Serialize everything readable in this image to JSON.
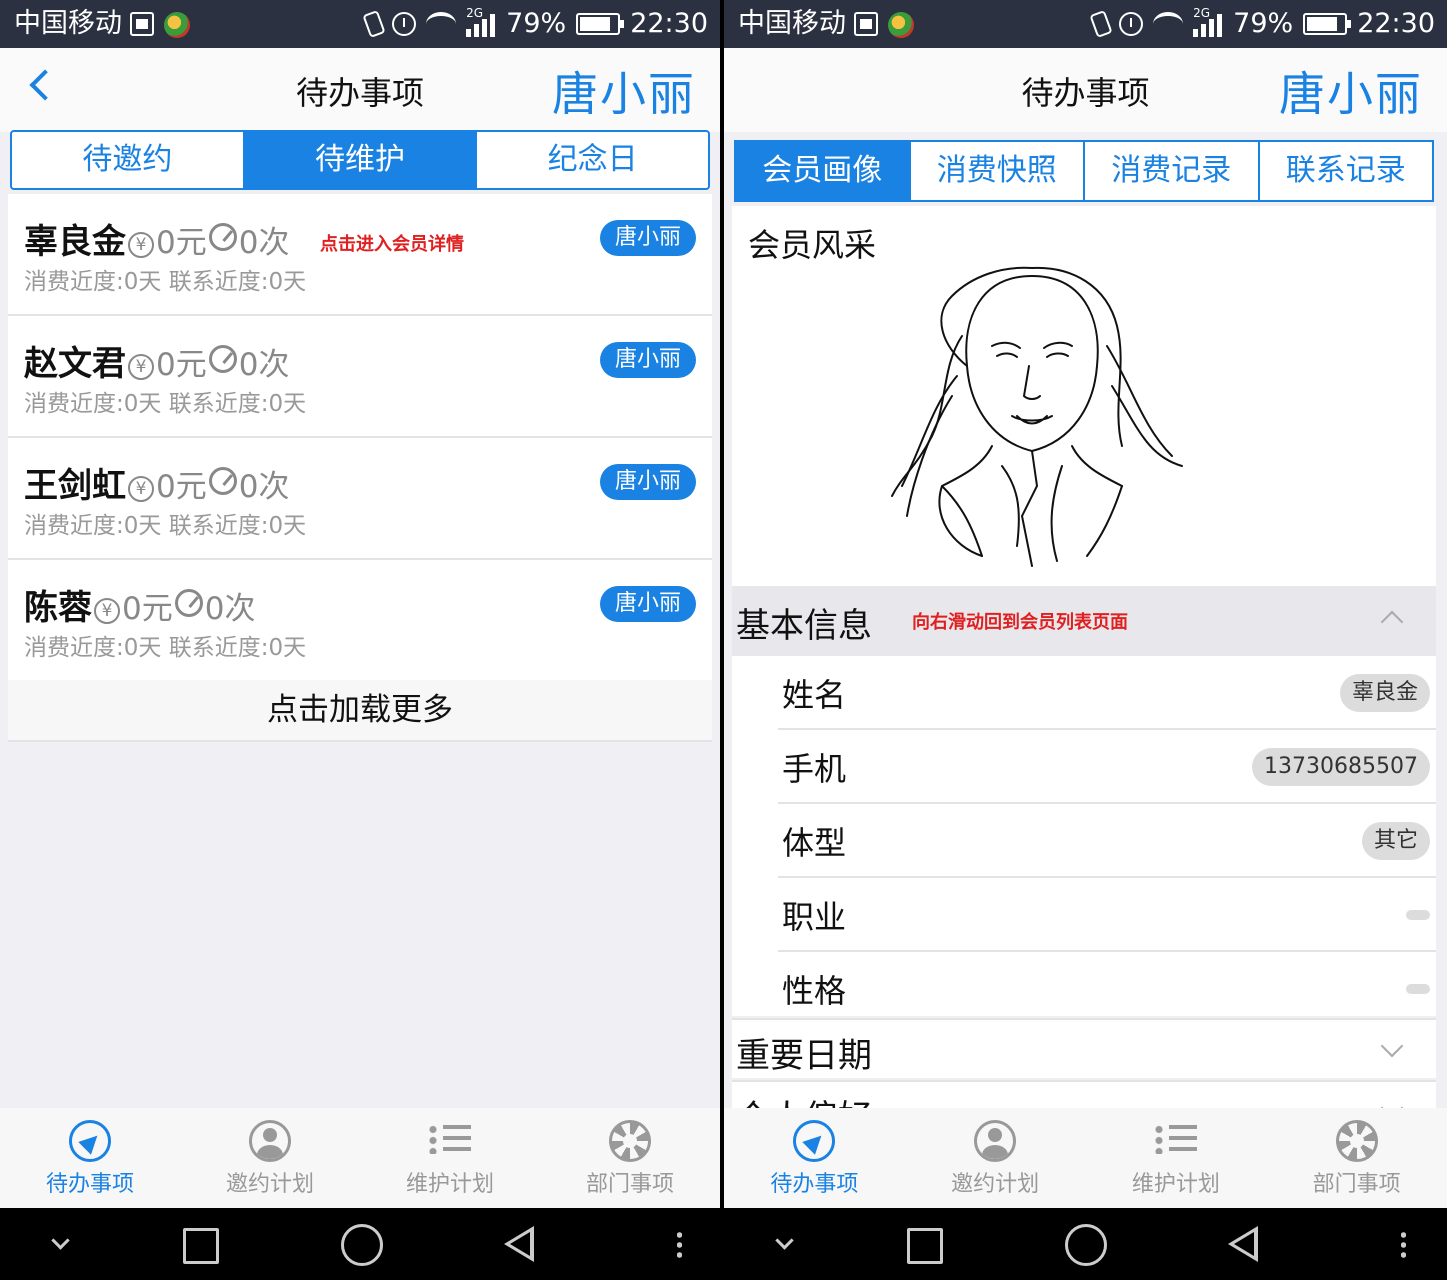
{
  "status_bar": {
    "carrier": "中国移动",
    "network": "2G",
    "battery": "79%",
    "time": "22:30"
  },
  "left": {
    "header": {
      "title": "待办事项",
      "user": "唐小丽"
    },
    "tabs": [
      {
        "label": "待邀约",
        "active": false
      },
      {
        "label": "待维护",
        "active": true
      },
      {
        "label": "纪念日",
        "active": false
      }
    ],
    "members": [
      {
        "name": "辜良金",
        "amount": "0元",
        "count": "0次",
        "recency": "消费近度:0天 联系近度:0天",
        "owner": "唐小丽",
        "hint": "点击进入会员详情"
      },
      {
        "name": "赵文君",
        "amount": "0元",
        "count": "0次",
        "recency": "消费近度:0天 联系近度:0天",
        "owner": "唐小丽"
      },
      {
        "name": "王剑虹",
        "amount": "0元",
        "count": "0次",
        "recency": "消费近度:0天 联系近度:0天",
        "owner": "唐小丽"
      },
      {
        "name": "陈蓉",
        "amount": "0元",
        "count": "0次",
        "recency": "消费近度:0天 联系近度:0天",
        "owner": "唐小丽"
      }
    ],
    "load_more": "点击加载更多"
  },
  "right": {
    "header": {
      "title": "待办事项",
      "user": "唐小丽"
    },
    "tabs": [
      {
        "label": "会员画像",
        "active": true
      },
      {
        "label": "消费快照",
        "active": false
      },
      {
        "label": "消费记录",
        "active": false
      },
      {
        "label": "联系记录",
        "active": false
      }
    ],
    "photo_label": "会员风采",
    "basic_info": {
      "label": "基本信息",
      "hint": "向右滑动回到会员列表页面",
      "rows": [
        {
          "label": "姓名",
          "value": "辜良金"
        },
        {
          "label": "手机",
          "value": "13730685507"
        },
        {
          "label": "体型",
          "value": "其它"
        },
        {
          "label": "职业",
          "value": ""
        },
        {
          "label": "性格",
          "value": ""
        }
      ]
    },
    "important_dates": "重要日期",
    "preferences_partial": "个人偏好"
  },
  "tab_bar": [
    {
      "label": "待办事项",
      "icon": "navigation-icon",
      "active": true
    },
    {
      "label": "邀约计划",
      "icon": "person-icon",
      "active": false
    },
    {
      "label": "维护计划",
      "icon": "list-icon",
      "active": false
    },
    {
      "label": "部门事项",
      "icon": "shutter-icon",
      "active": false
    }
  ],
  "colors": {
    "accent": "#1a82e2",
    "hint_red": "#e02020",
    "status_bar": "#2b3140"
  }
}
